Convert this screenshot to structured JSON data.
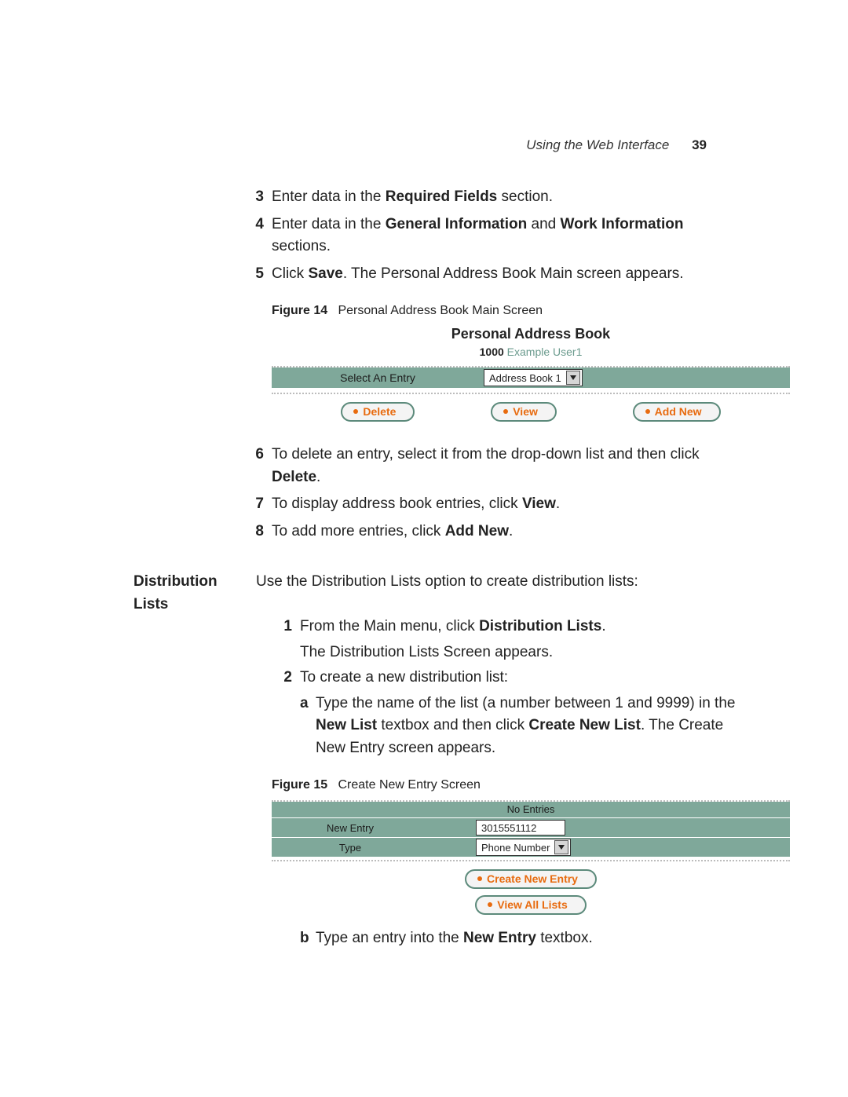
{
  "header": {
    "running_title": "Using the Web Interface",
    "page_number": "39"
  },
  "steps_a": [
    {
      "n": "3",
      "html": "Enter data in the <b>Required Fields</b> section."
    },
    {
      "n": "4",
      "html": "Enter data in the <b>General Information</b> and <b>Work Information</b> sections."
    },
    {
      "n": "5",
      "html": "Click <b>Save</b>. The Personal Address Book Main screen appears."
    }
  ],
  "figure14": {
    "label": "Figure 14",
    "caption": "Personal Address Book Main Screen",
    "title": "Personal Address Book",
    "extension": "1000",
    "user": "Example User1",
    "select_label": "Select An Entry",
    "select_value": "Address Book 1",
    "buttons": {
      "delete": "Delete",
      "view": "View",
      "addnew": "Add New"
    }
  },
  "steps_b": [
    {
      "n": "6",
      "html": "To delete an entry, select it from the drop-down list and then click <b>Delete</b>."
    },
    {
      "n": "7",
      "html": "To display address book entries, click <b>View</b>."
    },
    {
      "n": "8",
      "html": "To add more entries, click <b>Add New</b>."
    }
  ],
  "section": {
    "heading": "Distribution Lists",
    "intro": "Use the Distribution Lists option to create distribution lists:"
  },
  "dist_steps": {
    "s1a": "From the Main menu, click <b>Distribution Lists</b>.",
    "s1b": "The Distribution Lists Screen appears.",
    "s2": "To create a new distribution list:",
    "s2a": "Type the name of the list (a number between 1 and 9999) in the <b>New List</b> textbox and then click <b>Create New List</b>.",
    "s2a2": "The Create New Entry screen appears.",
    "s2b": "Type an entry into the <b>New Entry</b> textbox."
  },
  "figure15": {
    "label": "Figure 15",
    "caption": "Create New Entry Screen",
    "no_entries": "No Entries",
    "new_entry_label": "New Entry",
    "new_entry_value": "3015551112",
    "type_label": "Type",
    "type_value": "Phone Number",
    "btn_create": "Create New Entry",
    "btn_viewall": "View All Lists"
  }
}
